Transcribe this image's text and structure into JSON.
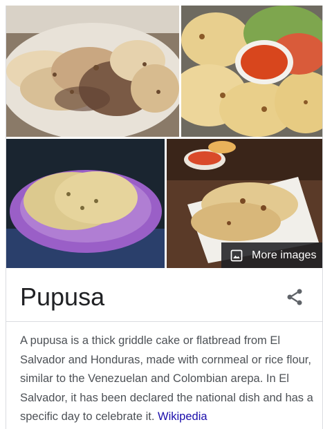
{
  "knowledge_panel": {
    "images": [
      {
        "name": "pupusa-platter-photo"
      },
      {
        "name": "pupusa-with-curtido-and-salsa-photo"
      },
      {
        "name": "pupusas-on-purple-bag-photo"
      },
      {
        "name": "pupusas-on-white-plate-photo"
      }
    ],
    "more_images_label": "More images",
    "more_images_icon": "image-icon",
    "title": "Pupusa",
    "share_icon": "share-icon",
    "description": "A pupusa is a thick griddle cake or flatbread from El Salvador and Honduras, made with cornmeal or rice flour, similar to the Venezuelan and Colombian arepa. In El Salvador, it has been declared the national dish and has a specific day to celebrate it.",
    "source_link": "Wikipedia"
  },
  "colors": {
    "link": "#1a0dab",
    "text": "#4d5156",
    "title": "#202124",
    "icon": "#5f6368"
  }
}
